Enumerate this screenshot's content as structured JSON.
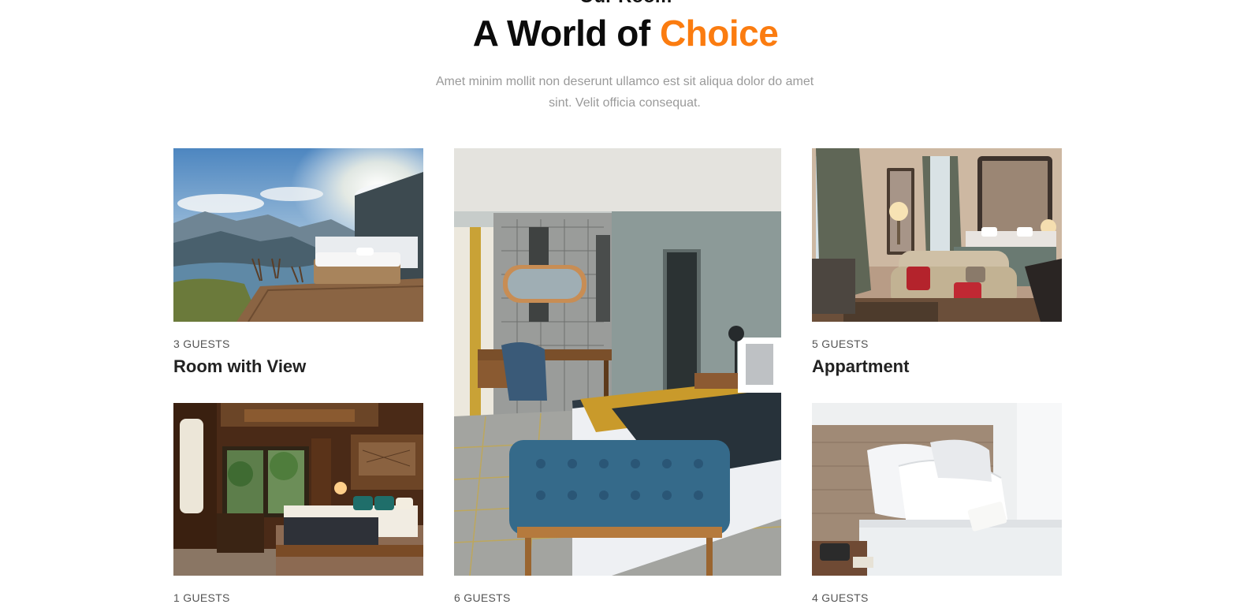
{
  "section": {
    "eyebrow": "Our Room",
    "title_main": "A World of ",
    "title_accent": "Choice",
    "subtitle": "Amet minim mollit non deserunt ullamco est sit aliqua dolor do amet sint. Velit officia consequat."
  },
  "rooms": [
    {
      "guests": "3 GUESTS",
      "name": "Room with View",
      "image": "mountain-view-room-photo"
    },
    {
      "guests": "6 GUESTS",
      "name": "",
      "image": "city-mural-bedroom-photo"
    },
    {
      "guests": "5 GUESTS",
      "name": "Appartment",
      "image": "luxury-apartment-photo"
    },
    {
      "guests": "1 GUESTS",
      "name": "",
      "image": "tropical-wood-bedroom-photo"
    },
    {
      "guests": "4 GUESTS",
      "name": "",
      "image": "white-pillows-bed-photo"
    }
  ],
  "colors": {
    "accent": "#fb7c10",
    "heading": "#0b0b0b",
    "muted": "#9a9a9a"
  }
}
